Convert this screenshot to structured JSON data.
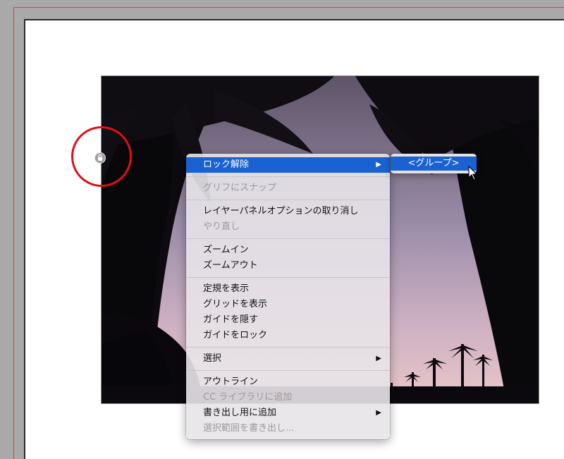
{
  "context_menu": {
    "groups": [
      [
        {
          "label": "ロック解除",
          "state": "highlighted",
          "has_submenu": true
        }
      ],
      [
        {
          "label": "グリフにスナップ",
          "state": "disabled"
        }
      ],
      [
        {
          "label": "レイヤーパネルオプションの取り消し",
          "state": "enabled"
        },
        {
          "label": "やり直し",
          "state": "disabled"
        }
      ],
      [
        {
          "label": "ズームイン",
          "state": "enabled"
        },
        {
          "label": "ズームアウト",
          "state": "enabled"
        }
      ],
      [
        {
          "label": "定規を表示",
          "state": "enabled"
        },
        {
          "label": "グリッドを表示",
          "state": "enabled"
        },
        {
          "label": "ガイドを隠す",
          "state": "enabled"
        },
        {
          "label": "ガイドをロック",
          "state": "enabled"
        }
      ],
      [
        {
          "label": "選択",
          "state": "enabled",
          "has_submenu": true
        }
      ],
      [
        {
          "label": "アウトライン",
          "state": "enabled"
        },
        {
          "label": "CC ライブラリに追加",
          "state": "disabled"
        },
        {
          "label": "書き出し用に追加",
          "state": "enabled",
          "has_submenu": true
        },
        {
          "label": "選択範囲を書き出し...",
          "state": "disabled"
        }
      ]
    ],
    "submenu_arrow": "▶"
  },
  "submenu": {
    "item": "<グループ>"
  },
  "icons": {
    "lock": "lock-icon",
    "cursor": "arrow-cursor"
  },
  "colors": {
    "highlight": "#1a62d2",
    "annotation_circle": "#e20e18",
    "bleed_guide": "#e43b3b"
  }
}
